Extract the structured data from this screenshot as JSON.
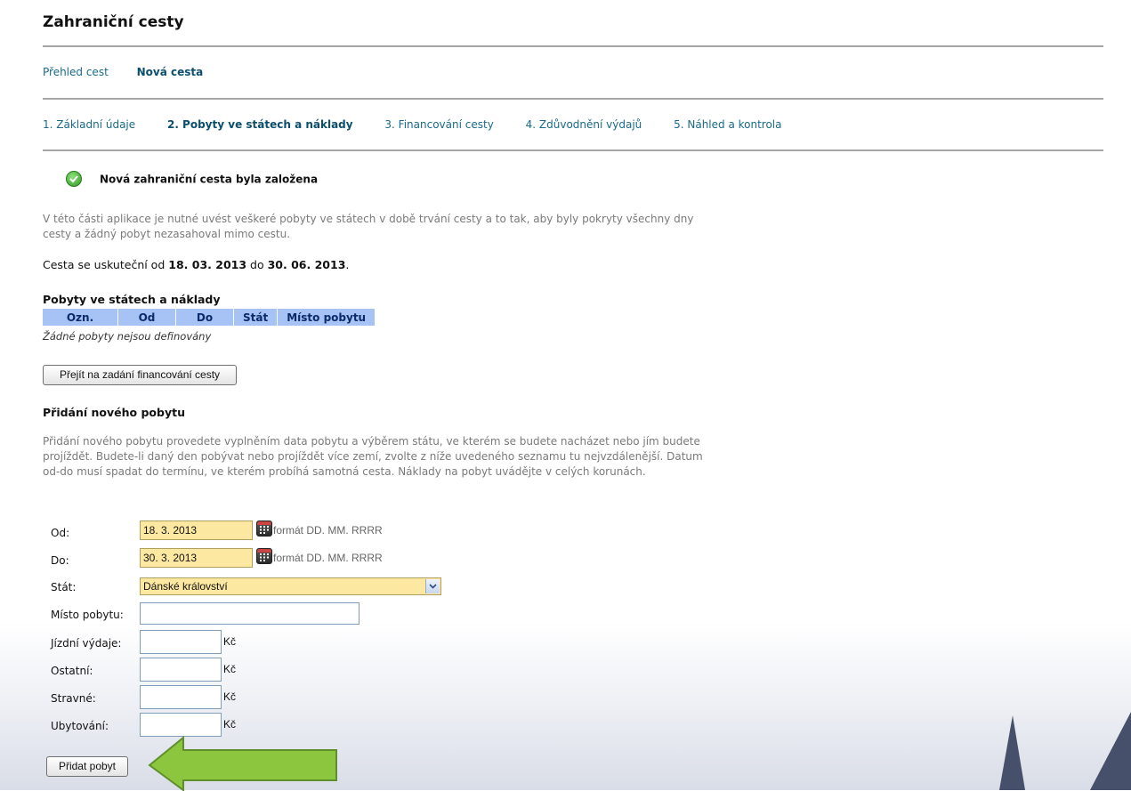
{
  "app": {
    "title": "Zahraniční cesty"
  },
  "nav": {
    "items": [
      {
        "label": "Přehled cest"
      },
      {
        "label": "Nová cesta"
      }
    ]
  },
  "steps": [
    {
      "label": "1. Základní údaje"
    },
    {
      "label": "2. Pobyty ve státech a náklady"
    },
    {
      "label": "3. Financování cesty"
    },
    {
      "label": "4. Zdůvodnění výdajů"
    },
    {
      "label": "5. Náhled a kontrola"
    }
  ],
  "notice": {
    "text": "Nová zahraniční cesta byla založena",
    "icon": "check-circle-icon",
    "color": "#2e9a23"
  },
  "intro": {
    "text": "V této části aplikace je nutné uvést veškeré pobyty ve státech v době trvání cesty a to tak, aby byly pokryty všechny dny cesty a žádný pobyt nezasahoval mimo cestu."
  },
  "trip": {
    "prefix": "Cesta se uskuteční od",
    "from": "18. 03. 2013",
    "middle": "do",
    "to": "30. 06. 2013",
    "suffix": "."
  },
  "stays": {
    "title": "Pobyty ve státech a náklady",
    "columns": [
      "Ozn.",
      "Od",
      "Do",
      "Stát",
      "Místo pobytu"
    ],
    "empty_text": "Žádné pobyty nejsou definovány",
    "header_color": "#a7c3f5"
  },
  "buttons": {
    "goto_financing": "Přejít na zadání financování cesty",
    "add_stay": "Přidat pobyt"
  },
  "add": {
    "title": "Přidání nového pobytu",
    "help": "Přidání nového pobytu provedete vyplněním data pobytu a výběrem státu, ve kterém se budete nacházet nebo jím budete projíždět. Budete-li daný den pobývat nebo projíždět více zemí, zvolte z níže uvedeného seznamu tu nejvzdálenější. Datum od-do musí spadat do termínu, ve kterém probíhá samotná cesta. Náklady na pobyt uvádějte v celých korunách."
  },
  "form": {
    "from_label": "Od:",
    "from_value": "18. 3. 2013",
    "to_label": "Do:",
    "to_value": "30. 3. 2013",
    "date_hint": "formát DD. MM. RRRR",
    "country_label": "Stát:",
    "country_value": "Dánské království",
    "place_label": "Místo pobytu:",
    "place_value": "",
    "travel_label": "Jízdní výdaje:",
    "other_label": "Ostatní:",
    "meals_label": "Stravné:",
    "lodging_label": "Ubytování:",
    "currency": "Kč",
    "field_color": "#fce8a0"
  },
  "annotation": {
    "icon": "green-arrow-left-icon",
    "color": "#8cc63f"
  }
}
